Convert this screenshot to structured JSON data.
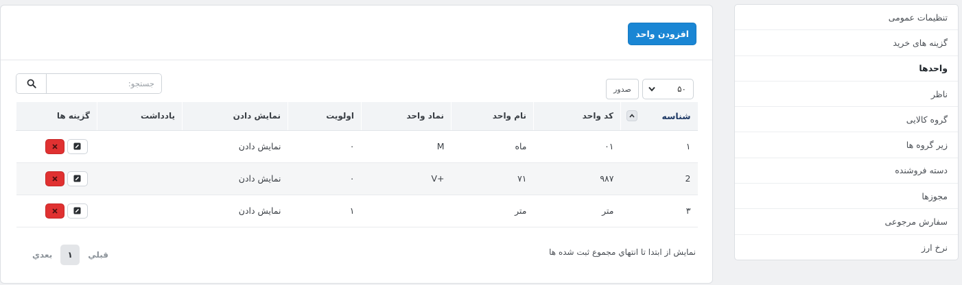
{
  "sidebar": {
    "items": [
      {
        "label": "تنظیمات عمومی",
        "active": false
      },
      {
        "label": "گزینه های خرید",
        "active": false
      },
      {
        "label": "واحدها",
        "active": true
      },
      {
        "label": "ناظر",
        "active": false
      },
      {
        "label": "گروه کالایی",
        "active": false
      },
      {
        "label": "زیر گروه ها",
        "active": false
      },
      {
        "label": "دسته فروشنده",
        "active": false
      },
      {
        "label": "مجوزها",
        "active": false
      },
      {
        "label": "سفارش مرجوعی",
        "active": false
      },
      {
        "label": "نرخ ارز",
        "active": false
      }
    ]
  },
  "header": {
    "add_button_label": "افزودن واحد"
  },
  "controls": {
    "search_placeholder": "جستجو:",
    "rows_label": "صدور",
    "rows_value": "۵۰"
  },
  "table": {
    "columns": {
      "id": "شناسه",
      "code": "کد واحد",
      "name": "نام واحد",
      "symbol": "نماد واحد",
      "priority": "اولویت",
      "display": "نمایش دادن",
      "note": "یادداشت",
      "options": "گزینه ها"
    },
    "rows": [
      {
        "id": "۱",
        "code": "۰۱",
        "name": "ماه",
        "symbol": "M",
        "priority": "۰",
        "display": "نمایش دادن",
        "note": ""
      },
      {
        "id": "2",
        "code": "۹۸۷",
        "name": "۷۱",
        "symbol": "+V",
        "priority": "۰",
        "display": "نمایش دادن",
        "note": ""
      },
      {
        "id": "۳",
        "code": "متر",
        "name": "متر",
        "symbol": "",
        "priority": "۱",
        "display": "نمایش دادن",
        "note": ""
      }
    ]
  },
  "footer": {
    "info": "نمایش از ابتدا تا انتهاي مجموع ثبت شده ها",
    "prev_label": "قبلي",
    "current_page": "۱",
    "next_label": "بعدي"
  },
  "colors": {
    "primary": "#1a86d4",
    "danger": "#e03131"
  }
}
